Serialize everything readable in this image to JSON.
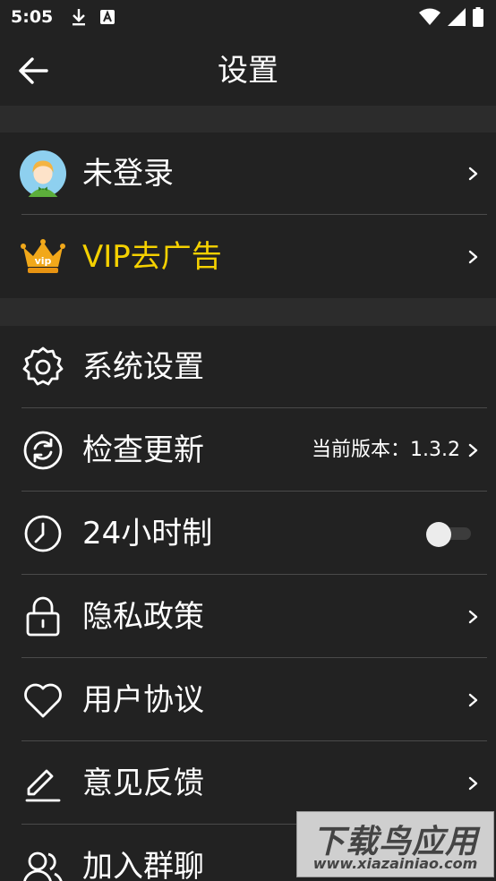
{
  "status_bar": {
    "time": "5:05",
    "icons": [
      "download-icon",
      "a-notification-icon",
      "wifi-icon",
      "signal-icon",
      "battery-icon"
    ]
  },
  "app_bar": {
    "title": "设置"
  },
  "account": {
    "login_label": "未登录",
    "vip_label": "VIP去广告",
    "vip_badge_text": "vip"
  },
  "settings": {
    "items": [
      {
        "label": "系统设置",
        "icon": "gear-icon"
      },
      {
        "label": "检查更新",
        "icon": "refresh-icon",
        "value": "当前版本：1.3.2"
      },
      {
        "label": "24小时制",
        "icon": "clock-icon"
      },
      {
        "label": "隐私政策",
        "icon": "lock-icon"
      },
      {
        "label": "用户协议",
        "icon": "heart-icon"
      },
      {
        "label": "意见反馈",
        "icon": "pencil-icon"
      },
      {
        "label": "加入群聊",
        "icon": "users-icon"
      }
    ]
  },
  "watermark": {
    "main": "下载鸟应用",
    "sub": "www.xiazainiao.com"
  },
  "colors": {
    "background": "#222222",
    "section_gap": "#2c2c2c",
    "vip_text": "#f5d100",
    "divider": "#4a4a4a"
  }
}
